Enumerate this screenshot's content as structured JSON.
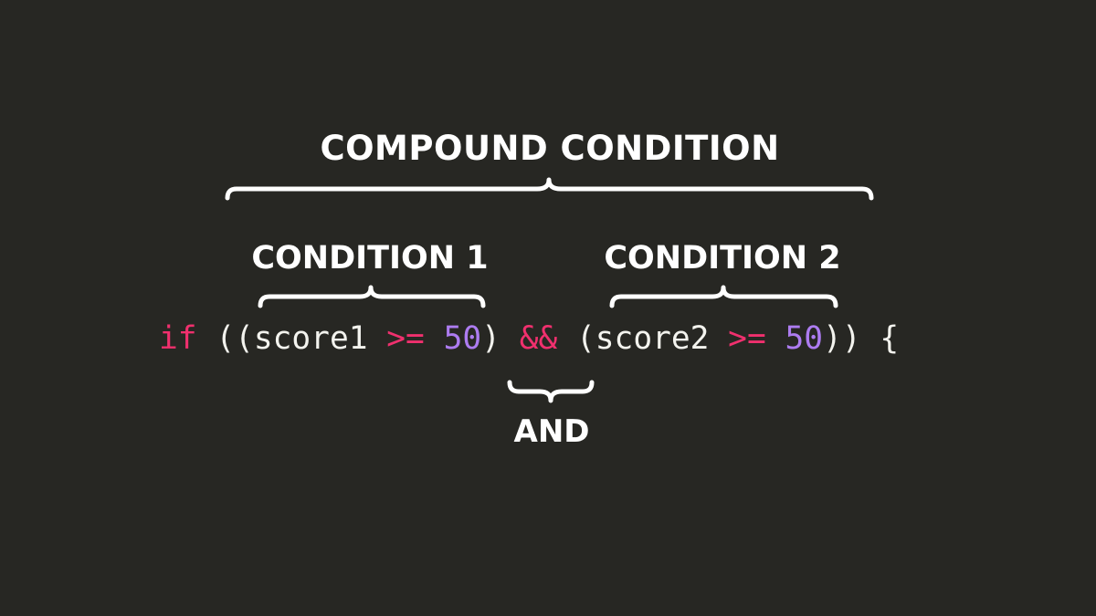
{
  "diagram": {
    "compound_label": "COMPOUND CONDITION",
    "condition1_label": "CONDITION 1",
    "condition2_label": "CONDITION 2",
    "and_label": "AND",
    "code_tokens": [
      {
        "text": "if",
        "kind": "keyword"
      },
      {
        "text": " ((score1 ",
        "kind": "plain"
      },
      {
        "text": ">=",
        "kind": "operator"
      },
      {
        "text": " ",
        "kind": "plain"
      },
      {
        "text": "50",
        "kind": "number"
      },
      {
        "text": ") ",
        "kind": "plain"
      },
      {
        "text": "&&",
        "kind": "operator"
      },
      {
        "text": " (score2 ",
        "kind": "plain"
      },
      {
        "text": ">=",
        "kind": "operator"
      },
      {
        "text": " ",
        "kind": "plain"
      },
      {
        "text": "50",
        "kind": "number"
      },
      {
        "text": ")) {",
        "kind": "plain"
      }
    ]
  },
  "colors": {
    "background": "#272723",
    "keyword": "#f0306e",
    "operator": "#f0306e",
    "number": "#ad7cf0",
    "plain": "#f3f3ee",
    "label": "#ffffff"
  }
}
